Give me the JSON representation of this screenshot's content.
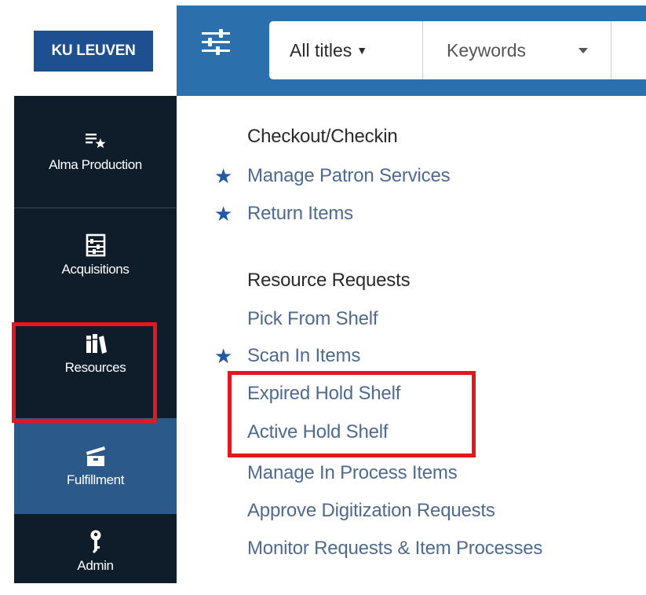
{
  "brand": {
    "logo_text": "KU LEUVEN",
    "logo_color": "#1d4f91"
  },
  "colors": {
    "nav_bg": "#0f1d2a",
    "topbar_bg": "#2b6fac",
    "link": "#4e6a8e",
    "star": "#1f5aa6",
    "highlight": "#e5161d"
  },
  "sidebar": {
    "items": [
      {
        "label": "Alma Production",
        "icon": "list-star-icon",
        "active": false
      },
      {
        "label": "Acquisitions",
        "icon": "abacus-icon",
        "active": false
      },
      {
        "label": "Resources",
        "icon": "books-icon",
        "active": false
      },
      {
        "label": "Fulfillment",
        "icon": "box-icon",
        "active": true
      },
      {
        "label": "Admin",
        "icon": "key-icon",
        "active": false
      }
    ]
  },
  "search": {
    "menu_icon": "sliders-icon",
    "scope_label": "All titles",
    "scope_caret": "▼",
    "field_label": "Keywords"
  },
  "menu": {
    "sections": [
      {
        "title": "Checkout/Checkin",
        "links": [
          {
            "label": "Manage Patron Services",
            "starred": true
          },
          {
            "label": "Return Items",
            "starred": true
          }
        ]
      },
      {
        "title": "Resource Requests",
        "links": [
          {
            "label": "Pick From Shelf",
            "starred": false
          },
          {
            "label": "Scan In Items",
            "starred": true
          },
          {
            "label": "Expired Hold Shelf",
            "starred": false,
            "highlighted": true
          },
          {
            "label": "Active Hold Shelf",
            "starred": false,
            "highlighted": true
          },
          {
            "label": "Manage In Process Items",
            "starred": false
          },
          {
            "label": "Approve Digitization Requests",
            "starred": false
          },
          {
            "label": "Monitor Requests & Item Processes",
            "starred": false
          }
        ]
      }
    ],
    "star_glyph": "★"
  }
}
